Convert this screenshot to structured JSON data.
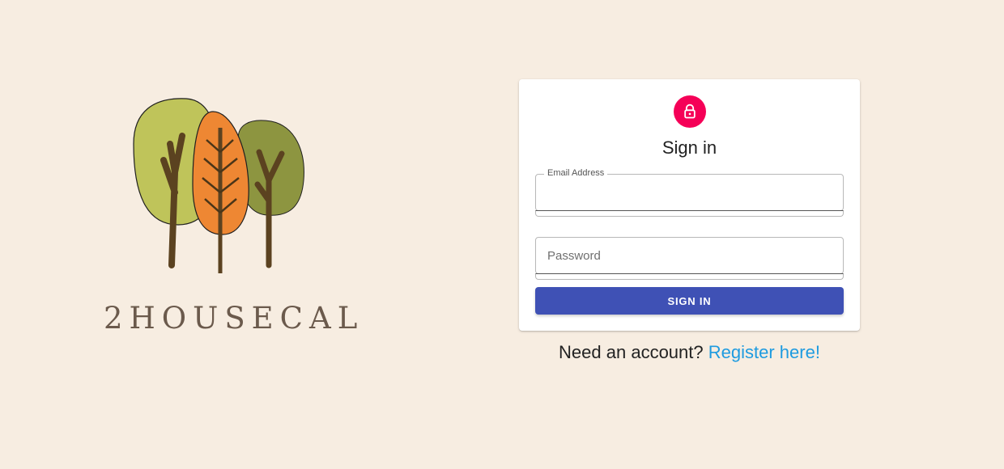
{
  "brand": {
    "name": "2HOUSECAL",
    "logo_icon": "trees-logo-icon"
  },
  "colors": {
    "background": "#f7ede1",
    "accent_pink": "#f50057",
    "primary_button": "#3f51b5",
    "link": "#1e9be0"
  },
  "signin_card": {
    "icon": "lock-icon",
    "title": "Sign in",
    "email": {
      "label": "Email Address",
      "value": ""
    },
    "password": {
      "placeholder": "Password",
      "value": ""
    },
    "submit_label": "SIGN IN"
  },
  "register": {
    "prompt": "Need an account?",
    "link_text": "Register here!"
  }
}
